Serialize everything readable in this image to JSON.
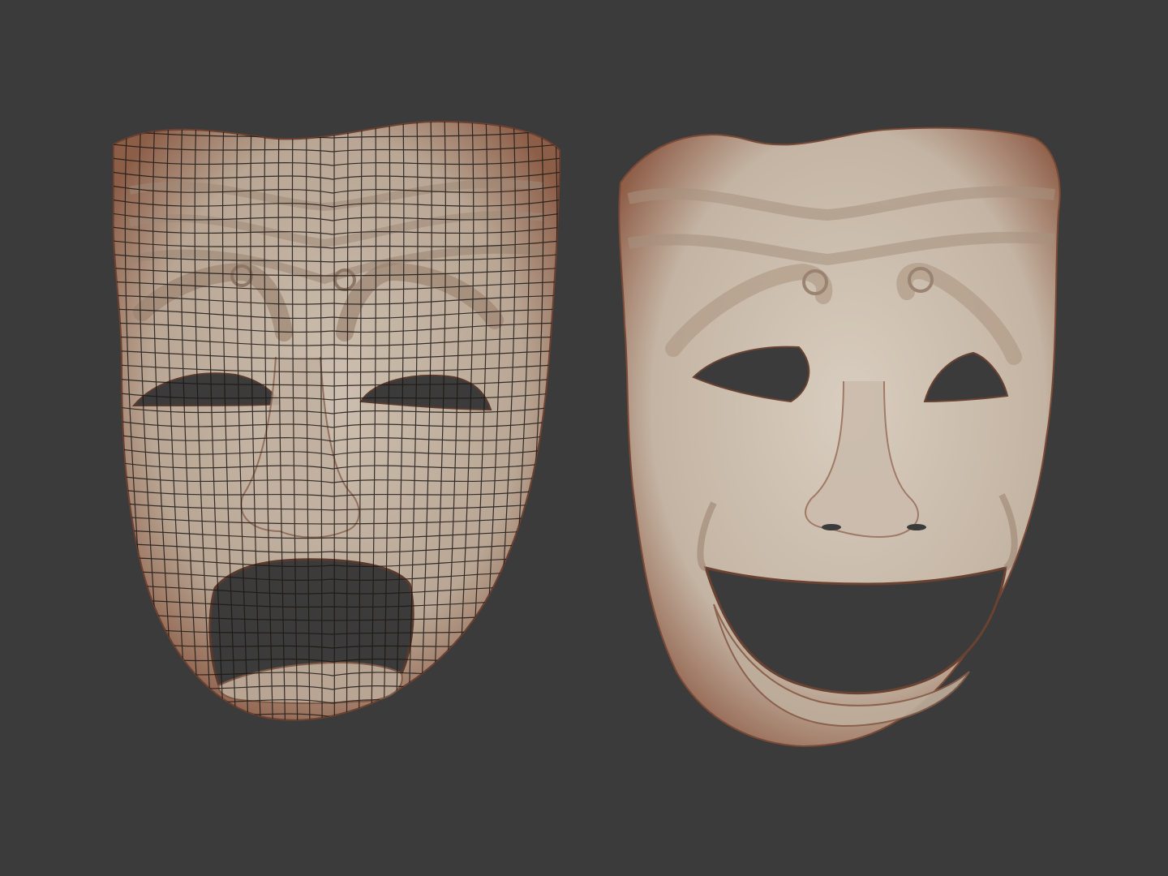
{
  "scene": {
    "background_color": "#3b3b3b",
    "objects": [
      {
        "name": "tragedy-mask",
        "display_mode": "wireframe-over-clay",
        "expression": "sad"
      },
      {
        "name": "comedy-mask",
        "display_mode": "smooth-clay",
        "expression": "happy"
      }
    ]
  },
  "colors": {
    "clay_light": "#cfc3b5",
    "clay_mid": "#b4a290",
    "clay_shadow": "#8a6350",
    "rim": "#7a4a36",
    "wire": "#1c1714"
  }
}
